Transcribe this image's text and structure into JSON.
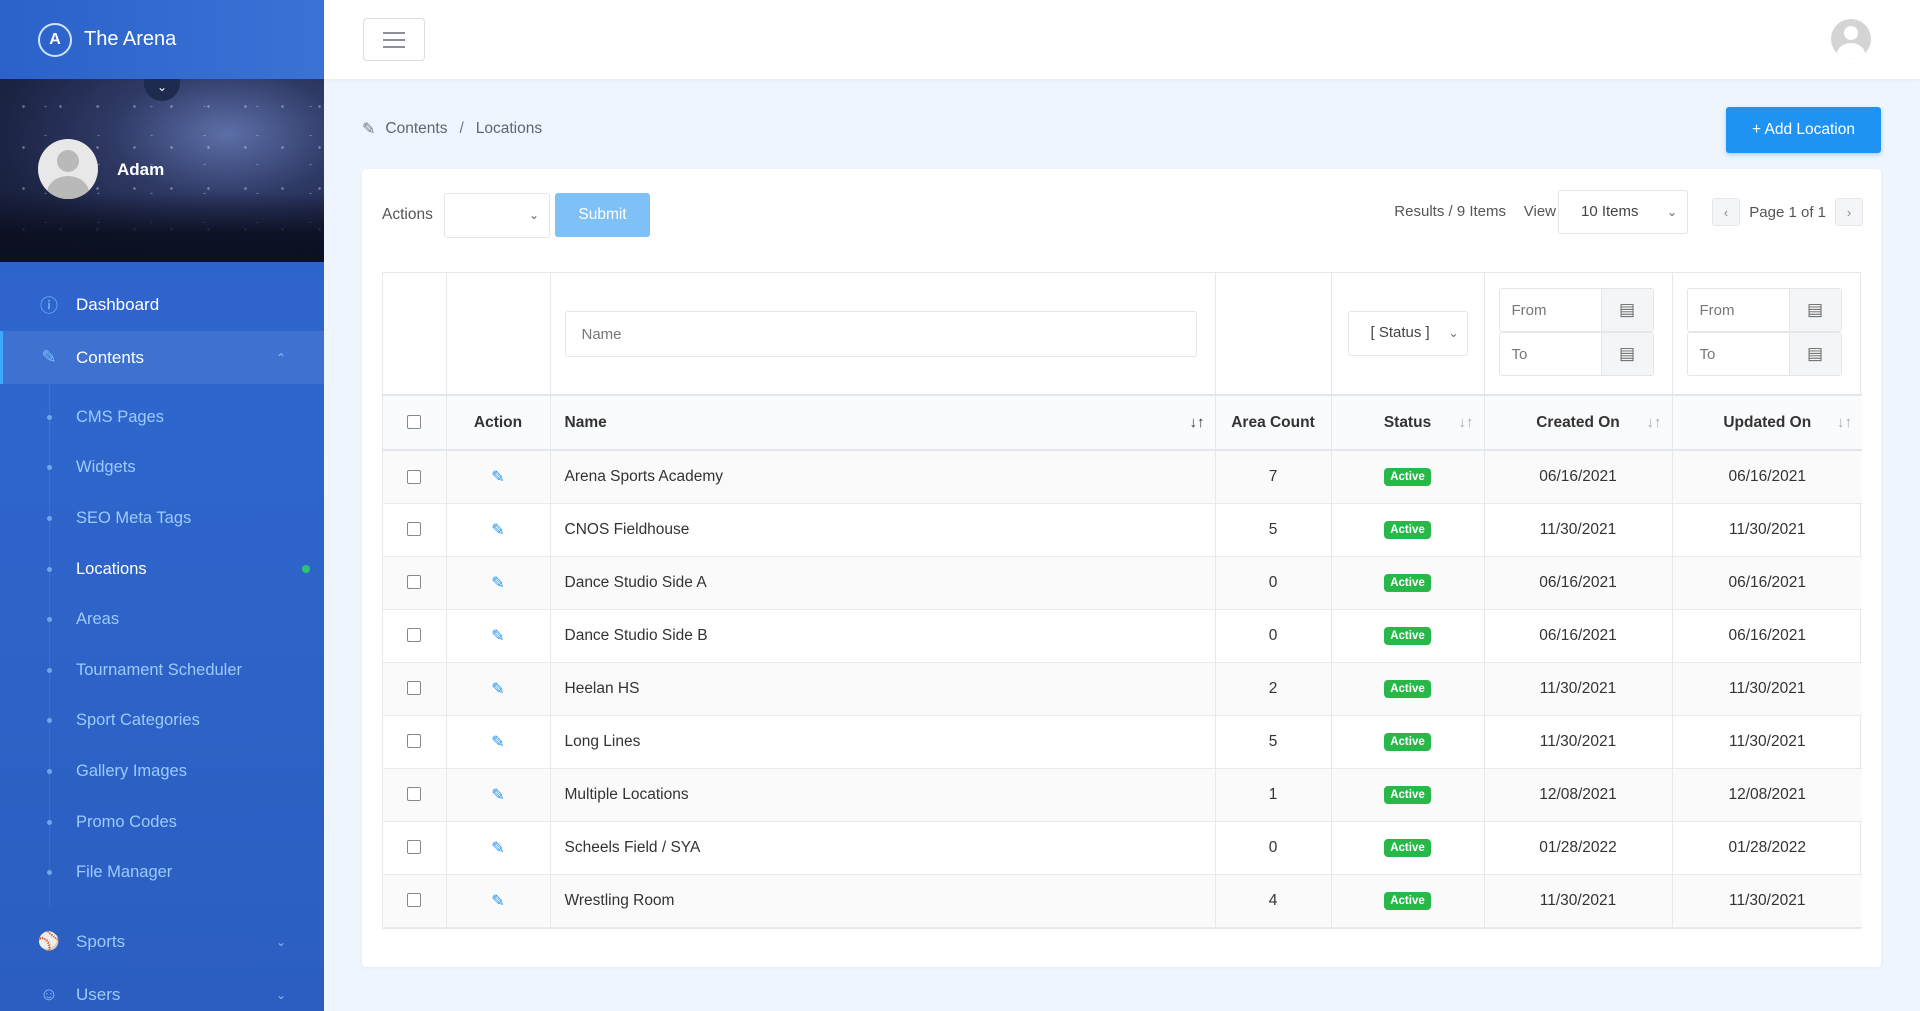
{
  "app": {
    "title": "The Arena",
    "logo_letter": "A"
  },
  "user": {
    "name": "Adam"
  },
  "sidebar": {
    "items": [
      {
        "label": "Dashboard",
        "icon": "info-icon"
      },
      {
        "label": "Contents",
        "icon": "edit-icon"
      }
    ],
    "sub_items": [
      {
        "label": "CMS Pages"
      },
      {
        "label": "Widgets"
      },
      {
        "label": "SEO Meta Tags"
      },
      {
        "label": "Locations",
        "current": true
      },
      {
        "label": "Areas"
      },
      {
        "label": "Tournament Scheduler"
      },
      {
        "label": "Sport Categories"
      },
      {
        "label": "Gallery Images"
      },
      {
        "label": "Promo Codes"
      },
      {
        "label": "File Manager"
      }
    ],
    "bottom_items": [
      {
        "label": "Sports",
        "icon": "ball-icon"
      },
      {
        "label": "Users",
        "icon": "user-icon"
      }
    ]
  },
  "breadcrumb": {
    "root": "Contents",
    "separator": "/",
    "current": "Locations"
  },
  "add_button": {
    "label": "+ Add Location"
  },
  "toolbar": {
    "actions_label": "Actions",
    "submit_label": "Submit",
    "results": "Results / 9 Items",
    "view_label": "View",
    "view_value": "10 Items",
    "page_text": "Page 1 of 1"
  },
  "filters": {
    "name_placeholder": "Name",
    "status_value": "[ Status ]",
    "created_from": "From",
    "created_to": "To",
    "updated_from": "From",
    "updated_to": "To"
  },
  "table": {
    "headers": {
      "action": "Action",
      "name": "Name",
      "area_count": "Area Count",
      "status": "Status",
      "created_on": "Created On",
      "updated_on": "Updated On"
    },
    "rows": [
      {
        "name": "Arena Sports Academy",
        "area_count": "7",
        "status": "Active",
        "created_on": "06/16/2021",
        "updated_on": "06/16/2021"
      },
      {
        "name": "CNOS Fieldhouse",
        "area_count": "5",
        "status": "Active",
        "created_on": "11/30/2021",
        "updated_on": "11/30/2021"
      },
      {
        "name": "Dance Studio Side A",
        "area_count": "0",
        "status": "Active",
        "created_on": "06/16/2021",
        "updated_on": "06/16/2021"
      },
      {
        "name": "Dance Studio Side B",
        "area_count": "0",
        "status": "Active",
        "created_on": "06/16/2021",
        "updated_on": "06/16/2021"
      },
      {
        "name": "Heelan HS",
        "area_count": "2",
        "status": "Active",
        "created_on": "11/30/2021",
        "updated_on": "11/30/2021"
      },
      {
        "name": "Long Lines",
        "area_count": "5",
        "status": "Active",
        "created_on": "11/30/2021",
        "updated_on": "11/30/2021"
      },
      {
        "name": "Multiple Locations",
        "area_count": "1",
        "status": "Active",
        "created_on": "12/08/2021",
        "updated_on": "12/08/2021"
      },
      {
        "name": "Scheels Field / SYA",
        "area_count": "0",
        "status": "Active",
        "created_on": "01/28/2022",
        "updated_on": "01/28/2022"
      },
      {
        "name": "Wrestling Room",
        "area_count": "4",
        "status": "Active",
        "created_on": "11/30/2021",
        "updated_on": "11/30/2021"
      }
    ]
  },
  "colors": {
    "accent": "#1f93f3",
    "sidebar": "#2f66cc",
    "status_active": "#28b84a"
  }
}
